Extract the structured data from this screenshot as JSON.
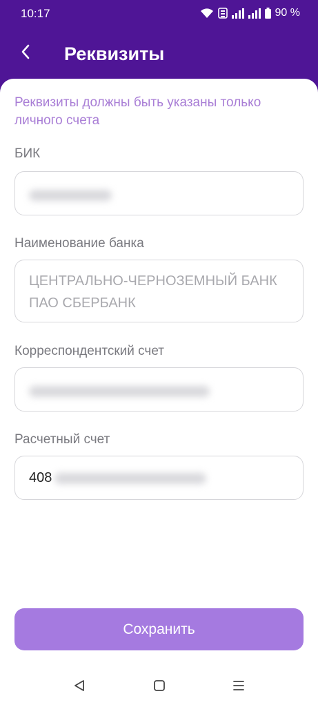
{
  "status_bar": {
    "time": "10:17",
    "battery": "90 %"
  },
  "header": {
    "title": "Реквизиты",
    "back_icon": "chevron-left-icon"
  },
  "notice": "Реквизиты должны быть указаны только личного счета",
  "form": {
    "bik": {
      "label": "БИК",
      "value": ""
    },
    "bank_name": {
      "label": "Наименование банка",
      "value": "ЦЕНТРАЛЬНО-ЧЕРНОЗЕМНЫЙ БАНК ПАО СБЕРБАНК"
    },
    "corr_account": {
      "label": "Корреспондентский счет",
      "value": ""
    },
    "settlement_account": {
      "label": "Расчетный счет",
      "value_prefix": "408"
    }
  },
  "save_button": "Сохранить",
  "colors": {
    "header_bg": "#4f1596",
    "accent": "#a57ae0",
    "notice_text": "#a97ed6"
  },
  "nav_bar": {
    "back": "triangle-back-icon",
    "home": "square-home-icon",
    "menu": "menu-icon"
  }
}
